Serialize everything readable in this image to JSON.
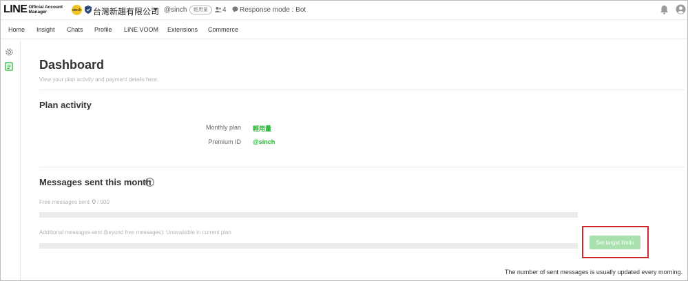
{
  "header": {
    "logo_main": "LINE",
    "logo_sub_line1": "Official Account",
    "logo_sub_line2": "Manager",
    "account_avatar_text": "sinch",
    "account_name": "台灣新趨有限公司",
    "account_id": "@sinch",
    "plan_badge": "輕用量",
    "friends_count": "4",
    "response_mode": "Response mode : Bot"
  },
  "nav": {
    "items": [
      {
        "label": "Home"
      },
      {
        "label": "Insight"
      },
      {
        "label": "Chats"
      },
      {
        "label": "Profile"
      },
      {
        "label": "LINE VOOM"
      },
      {
        "label": "Extensions"
      },
      {
        "label": "Commerce"
      }
    ]
  },
  "page": {
    "title": "Dashboard",
    "subtitle": "View your plan activity and payment details here."
  },
  "plan_activity": {
    "title": "Plan activity",
    "monthly_plan_label": "Monthly plan",
    "monthly_plan_value": "輕用量",
    "premium_id_label": "Premium ID",
    "premium_id_value": "@sinch"
  },
  "messages": {
    "title": "Messages sent this month",
    "free_label": "Free messages sent: ",
    "free_used": "0",
    "free_total": " / 500",
    "free_progress": 0,
    "additional_label": "Additional messages sent (beyond free messages): Unavailable in current plan",
    "set_target_button": "Set target limits",
    "footnote": "The number of sent messages is usually updated every morning."
  },
  "colors": {
    "accent_green": "#21b530",
    "button_disabled_green": "#a8e0ae",
    "highlight_red": "#d0232a"
  },
  "icons": [
    "shield-icon",
    "caret-down-icon",
    "people-icon",
    "chat-bubble-icon",
    "bell-icon",
    "user-icon",
    "gear-icon",
    "document-icon",
    "help-icon"
  ]
}
